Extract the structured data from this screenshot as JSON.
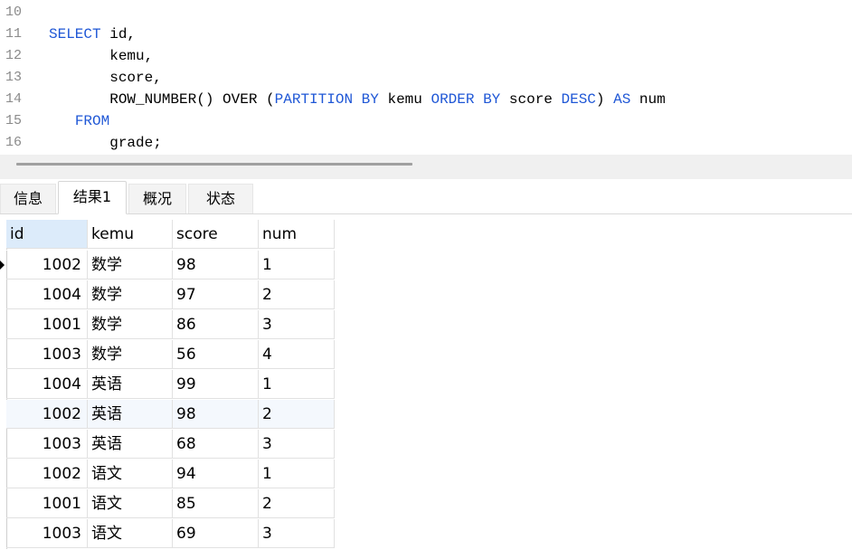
{
  "editor": {
    "lines": [
      {
        "num": "10",
        "segments": []
      },
      {
        "num": "11",
        "segments": [
          {
            "t": "SELECT",
            "k": true
          },
          {
            "t": " id,",
            "k": false
          }
        ]
      },
      {
        "num": "12",
        "segments": [
          {
            "t": "       kemu,",
            "k": false
          }
        ]
      },
      {
        "num": "13",
        "segments": [
          {
            "t": "       score,",
            "k": false
          }
        ]
      },
      {
        "num": "14",
        "segments": [
          {
            "t": "       ROW_NUMBER() OVER (",
            "k": false
          },
          {
            "t": "PARTITION BY",
            "k": true
          },
          {
            "t": " kemu ",
            "k": false
          },
          {
            "t": "ORDER BY",
            "k": true
          },
          {
            "t": " score ",
            "k": false
          },
          {
            "t": "DESC",
            "k": true
          },
          {
            "t": ") ",
            "k": false
          },
          {
            "t": "AS",
            "k": true
          },
          {
            "t": " num",
            "k": false
          }
        ]
      },
      {
        "num": "15",
        "segments": [
          {
            "t": "   ",
            "k": false
          },
          {
            "t": "FROM",
            "k": true
          }
        ]
      },
      {
        "num": "16",
        "segments": [
          {
            "t": "       grade;",
            "k": false
          }
        ]
      }
    ]
  },
  "tabs": [
    {
      "label": "信息",
      "active": false
    },
    {
      "label": "结果1",
      "active": true
    },
    {
      "label": "概况",
      "active": false
    },
    {
      "label": "状态",
      "active": false
    }
  ],
  "grid": {
    "columns": [
      "id",
      "kemu",
      "score",
      "num"
    ],
    "rows": [
      [
        "1002",
        "数学",
        "98",
        "1"
      ],
      [
        "1004",
        "数学",
        "97",
        "2"
      ],
      [
        "1001",
        "数学",
        "86",
        "3"
      ],
      [
        "1003",
        "数学",
        "56",
        "4"
      ],
      [
        "1004",
        "英语",
        "99",
        "1"
      ],
      [
        "1002",
        "英语",
        "98",
        "2"
      ],
      [
        "1003",
        "英语",
        "68",
        "3"
      ],
      [
        "1002",
        "语文",
        "94",
        "1"
      ],
      [
        "1001",
        "语文",
        "85",
        "2"
      ],
      [
        "1003",
        "语文",
        "69",
        "3"
      ]
    ],
    "current_row": 0,
    "highlight_row": 5
  },
  "colors": {
    "keyword": "#1f57d6",
    "header_selected": "#dcebfa"
  }
}
